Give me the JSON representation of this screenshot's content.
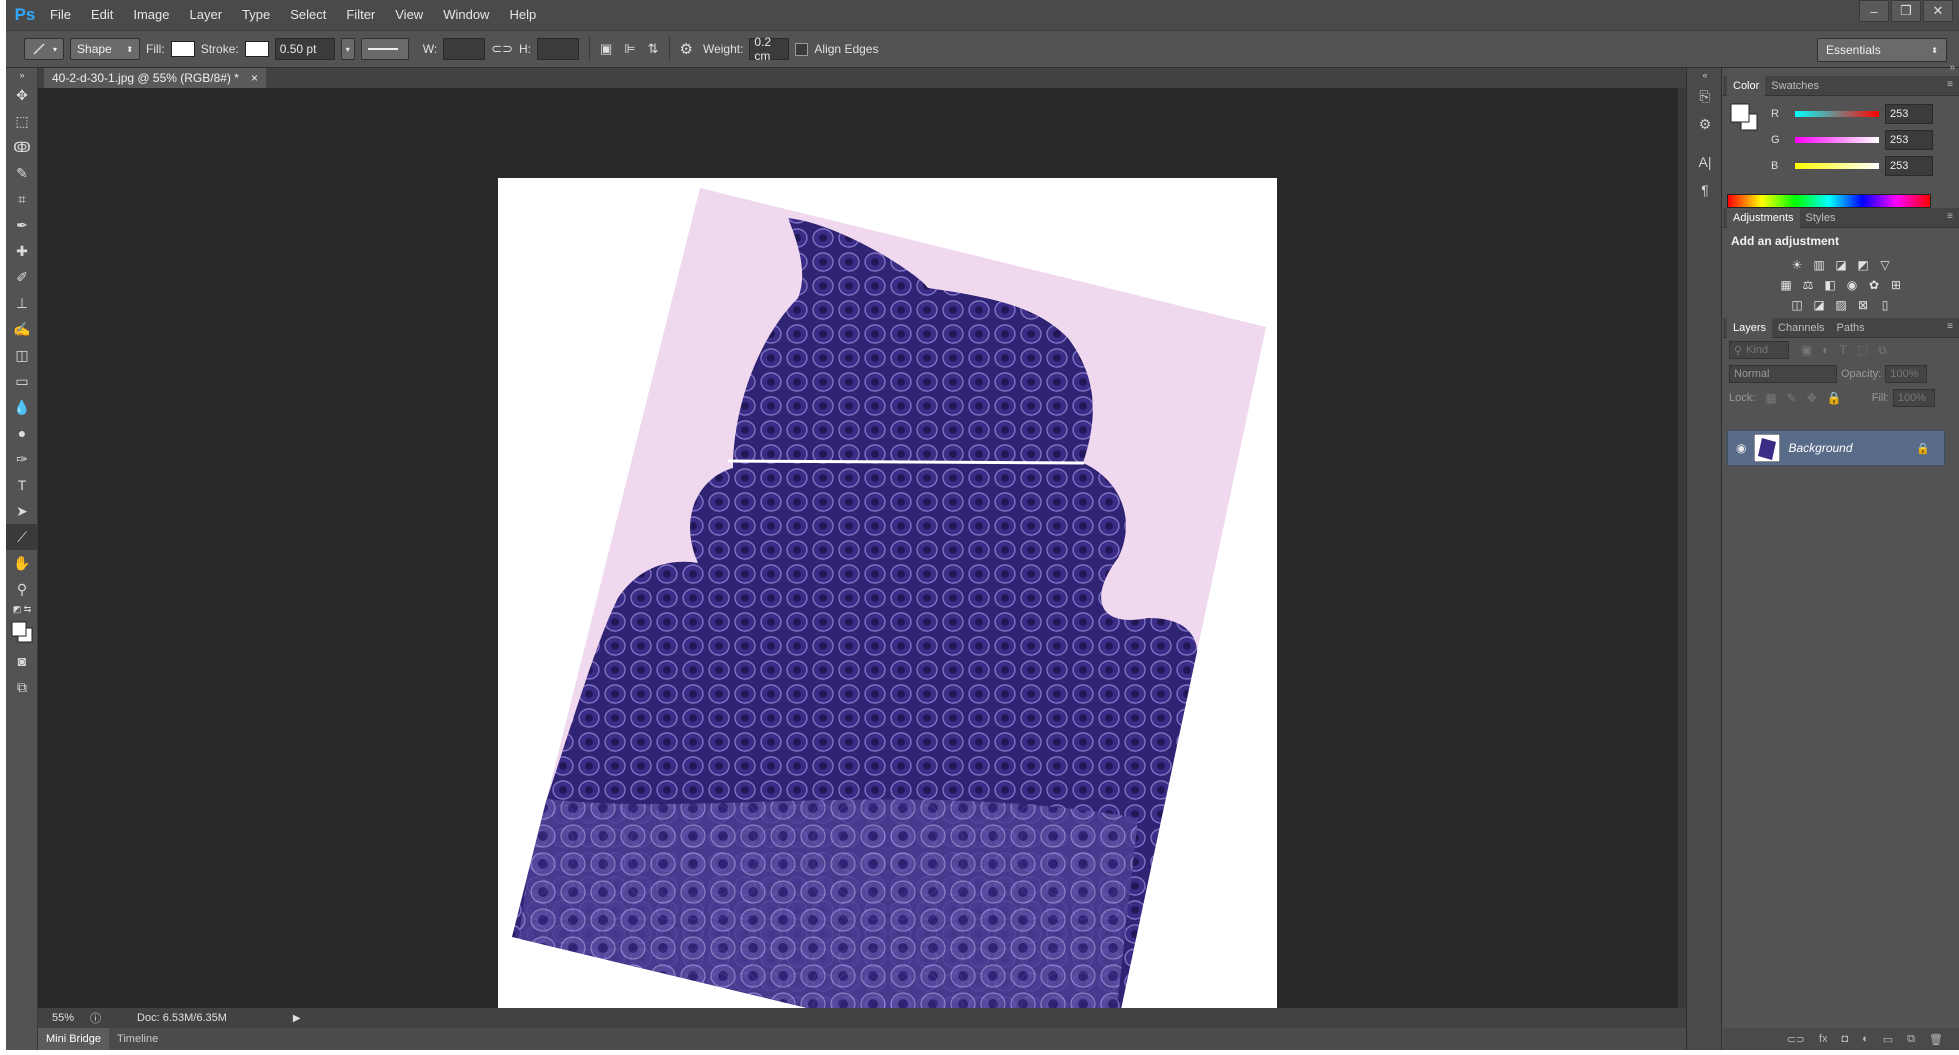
{
  "app": {
    "logo": "Ps"
  },
  "menu": [
    "File",
    "Edit",
    "Image",
    "Layer",
    "Type",
    "Select",
    "Filter",
    "View",
    "Window",
    "Help"
  ],
  "window_controls": [
    "–",
    "❐",
    "✕"
  ],
  "options": {
    "mode": "Shape",
    "fill_label": "Fill:",
    "stroke_label": "Stroke:",
    "stroke_width": "0.50 pt",
    "w_label": "W:",
    "h_label": "H:",
    "weight_label": "Weight:",
    "weight_value": "0.2 cm",
    "align_edges": "Align Edges",
    "workspace": "Essentials"
  },
  "document": {
    "tab_title": "40-2-d-30-1.jpg @ 55% (RGB/8#) *",
    "tab_close": "×"
  },
  "status": {
    "zoom": "55%",
    "doc_size": "Doc: 6.53M/6.35M"
  },
  "bottom_tabs": [
    "Mini Bridge",
    "Timeline"
  ],
  "color_panel": {
    "tabs": [
      "Color",
      "Swatches"
    ],
    "channels": [
      {
        "label": "R",
        "value": "253",
        "color": "#17c6e0"
      },
      {
        "label": "G",
        "value": "253",
        "color": "#e021d3"
      },
      {
        "label": "B",
        "value": "253",
        "color": "#e6e20f"
      }
    ]
  },
  "adjustments_panel": {
    "tabs": [
      "Adjustments",
      "Styles"
    ],
    "title": "Add an adjustment"
  },
  "layers_panel": {
    "tabs": [
      "Layers",
      "Channels",
      "Paths"
    ],
    "filter_kind": "Kind",
    "blend_mode": "Normal",
    "opacity_label": "Opacity:",
    "opacity_value": "100%",
    "lock_label": "Lock:",
    "fill_label": "Fill:",
    "fill_value": "100%",
    "layers": [
      {
        "name": "Background",
        "locked": true
      }
    ]
  },
  "colors": {
    "specimen_dark": "#2c1e6e",
    "specimen_mid": "#4a3a92",
    "slide_bg": "#f0d8ef",
    "layer_selected": "#586b88"
  }
}
